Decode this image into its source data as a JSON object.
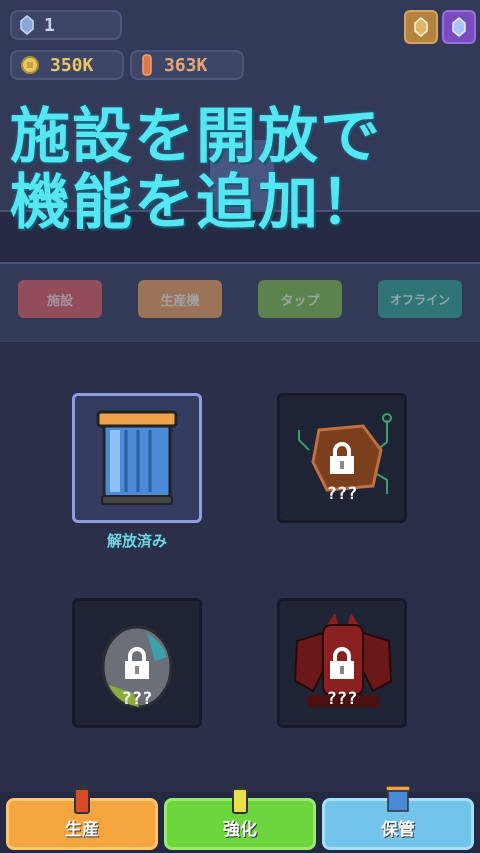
{
  "resources": {
    "gem_count": "1",
    "coins": "350K",
    "crystals": "363K"
  },
  "promo": {
    "line1": "施設を開放で",
    "line2": "機能を追加！"
  },
  "tabs": [
    {
      "label": "施設"
    },
    {
      "label": "生産機"
    },
    {
      "label": "タップ"
    },
    {
      "label": "オフライン"
    }
  ],
  "facilities": [
    {
      "status": "解放済み",
      "locked": false
    },
    {
      "label": "???",
      "locked": true
    },
    {
      "label": "???",
      "locked": true
    },
    {
      "label": "???",
      "locked": true
    }
  ],
  "bottom_nav": [
    {
      "label": "生産"
    },
    {
      "label": "強化"
    },
    {
      "label": "保管"
    }
  ],
  "colors": {
    "accent_cyan": "#54e6f3",
    "unlocked_text": "#6fd8e6",
    "btn_production": "#f5a53e",
    "btn_upgrade": "#6cd63f",
    "btn_storage": "#72c4ea"
  }
}
